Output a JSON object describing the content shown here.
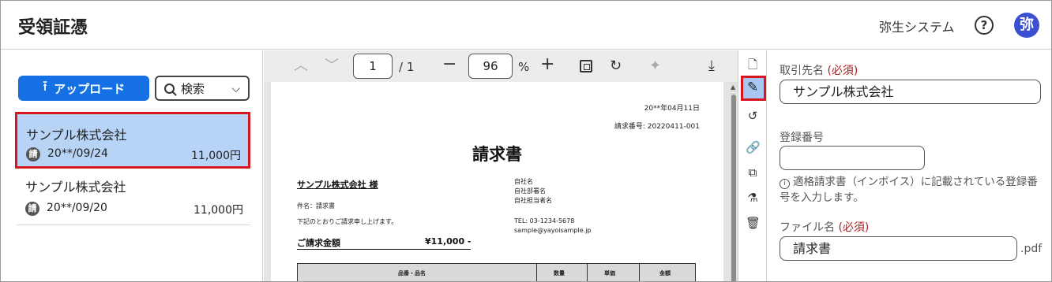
{
  "header": {
    "title": "受領証憑",
    "company": "弥生システム",
    "help_glyph": "?",
    "avatar_glyph": "弥"
  },
  "left": {
    "upload_label": "アップロード",
    "search_label": "検索",
    "items": [
      {
        "name": "サンプル株式会社",
        "badge": "請",
        "date": "20**/09/24",
        "amount": "11,000円",
        "selected": true
      },
      {
        "name": "サンプル株式会社",
        "badge": "請",
        "date": "20**/09/20",
        "amount": "11,000円",
        "selected": false
      }
    ]
  },
  "viewer": {
    "page_value": "1",
    "page_total": "/ 1",
    "zoom_value": "96",
    "zoom_unit": "%",
    "icons": [
      "chevron-up-icon",
      "chevron-down-icon",
      "zoom-out-icon",
      "zoom-in-icon",
      "fit-page-icon",
      "rotate-icon",
      "magic-wand-icon",
      "download-icon"
    ],
    "document": {
      "date": "20**年04月11日",
      "number": "請求番号: 20220411-001",
      "title": "請求書",
      "client": "サンプル株式会社 様",
      "subject": "件名：請求書",
      "note": "下記のとおりご請求申し上げます。",
      "total_label": "ご請求金額",
      "total_value": "¥11,000 -",
      "sender_name": "自社名",
      "sender_dept": "自社部署名",
      "sender_person": "自社担当者名",
      "tel": "TEL: 03-1234-5678",
      "email": "sample@yayoisample.jp",
      "table_headers": [
        "品番・品名",
        "数量",
        "単価",
        "金額"
      ]
    }
  },
  "rail": {
    "icons": [
      "document-icon",
      "pencil-icon",
      "history-icon",
      "link-icon",
      "copy-icon",
      "split-icon",
      "trash-icon"
    ],
    "active": "pencil-icon"
  },
  "form": {
    "partner_label": "取引先名",
    "required": "(必須)",
    "partner_value": "サンプル株式会社",
    "reg_label": "登録番号",
    "reg_value": "",
    "reg_hint": "適格請求書（インボイス）に記載されている登録番号を入力します。",
    "filename_label": "ファイル名",
    "filename_value": "請求書",
    "filename_ext": ".pdf"
  },
  "colors": {
    "accent": "#1570e4",
    "selected_bg": "#b7d3f5",
    "highlight_border": "#d7161f",
    "avatar_bg": "#3d4fd1",
    "required_text": "#b11b1b"
  }
}
